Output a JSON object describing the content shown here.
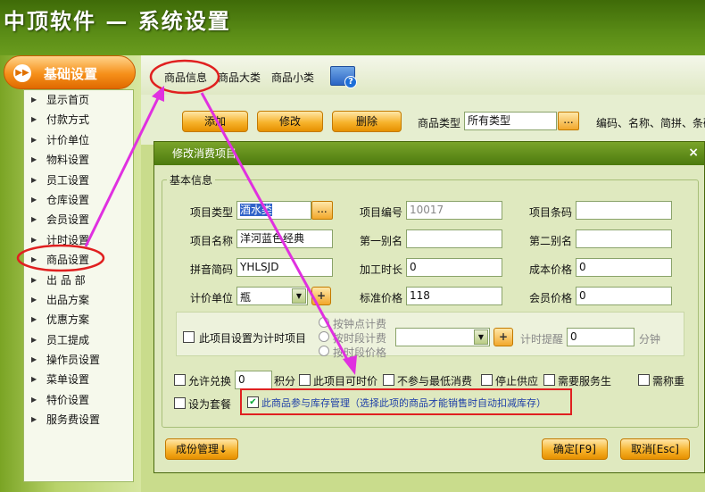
{
  "app": {
    "title": "中顶软件 — 系统设置"
  },
  "sidebar": {
    "header": "基础设置",
    "items": [
      "显示首页",
      "付款方式",
      "计价单位",
      "物料设置",
      "员工设置",
      "仓库设置",
      "会员设置",
      "计时设置",
      "商品设置",
      "出 品 部",
      "出品方案",
      "优惠方案",
      "员工提成",
      "操作员设置",
      "菜单设置",
      "特价设置",
      "服务费设置"
    ]
  },
  "tabs": [
    "商品信息",
    "商品大类",
    "商品小类"
  ],
  "toolbar": {
    "add": "添加",
    "edit": "修改",
    "delete": "删除",
    "type_label": "商品类型",
    "type_value": "所有类型",
    "dots": "...",
    "search_label": "编码、名称、简拼、条码"
  },
  "dialog": {
    "title": "修改消费项目",
    "close": "×",
    "group": "基本信息",
    "fields": {
      "type": {
        "label": "项目类型",
        "value": "酒水类"
      },
      "code": {
        "label": "项目编号",
        "value": "10017"
      },
      "barcode": {
        "label": "项目条码",
        "value": ""
      },
      "name": {
        "label": "项目名称",
        "value": "洋河蓝色经典"
      },
      "alias1": {
        "label": "第一别名",
        "value": ""
      },
      "alias2": {
        "label": "第二别名",
        "value": ""
      },
      "pinyin": {
        "label": "拼音简码",
        "value": "YHLSJD"
      },
      "process_time": {
        "label": "加工时长",
        "value": "0"
      },
      "cost": {
        "label": "成本价格",
        "value": "0"
      },
      "unit": {
        "label": "计价单位",
        "value": "瓶"
      },
      "price": {
        "label": "标准价格",
        "value": "118"
      },
      "member_price": {
        "label": "会员价格",
        "value": "0"
      }
    },
    "timed": {
      "checkbox": "此项目设置为计时项目",
      "options": [
        "按钟点计费",
        "按时段计费",
        "按时段价格"
      ],
      "remind_label": "计时提醒",
      "remind_value": "0",
      "remind_unit": "分钟"
    },
    "options": {
      "allow_exchange": "允许兑换",
      "points_value": "0",
      "points_unit": "积分",
      "timed_price": "此项目可时价",
      "no_min": "不参与最低消费",
      "stop_supply": "停止供应",
      "need_service": "需要服务生",
      "need_weigh": "需称重",
      "set_combo": "设为套餐",
      "inventory": "此商品参与库存管理（选择此项的商品才能销售时自动扣减库存）"
    },
    "buttons": {
      "cost_mgmt": "成份管理↓",
      "ok": "确定[F9]",
      "cancel": "取消[Esc]"
    }
  },
  "colors": {
    "accent_orange": "#f6901a",
    "bg_green": "#4e7d0c",
    "highlight_red": "#e02020",
    "arrow_magenta": "#e030e0"
  },
  "icons": [
    "help-icon",
    "right-triangle-icon",
    "checkmark-icon",
    "dropdown-arrow-icon",
    "plus-icon"
  ]
}
